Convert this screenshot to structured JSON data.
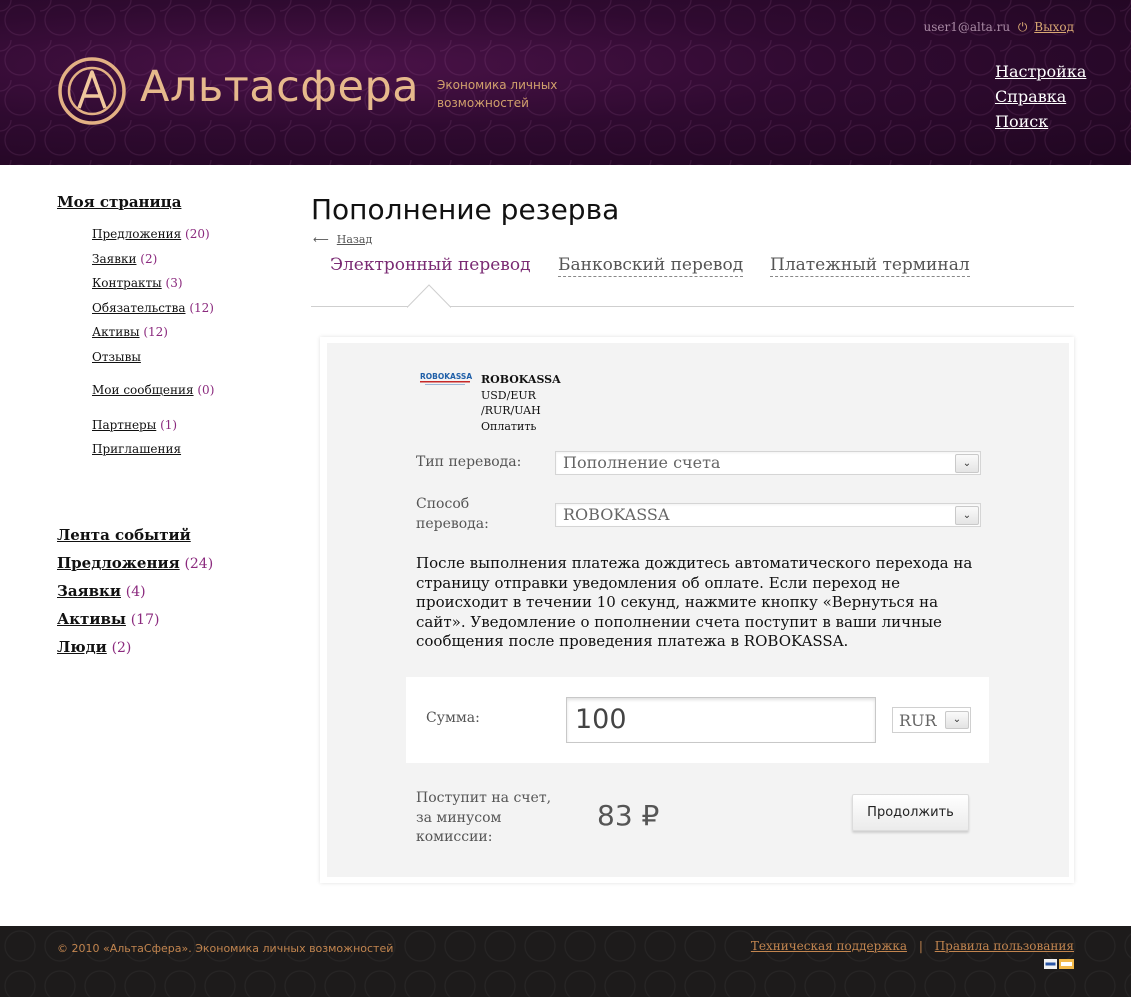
{
  "header": {
    "logo_text": "Альтасфера",
    "tagline": "Экономика личных возможностей",
    "user_email": "user1@alta.ru",
    "logout_label": "Выход",
    "nav": [
      "Настройка",
      "Справка",
      "Поиск"
    ],
    "colors": {
      "background": "#2f0a30",
      "logo": "#e6b98c"
    }
  },
  "sidebar": {
    "my_page": "Моя страница",
    "items": [
      {
        "label": "Предложения",
        "count": "(20)"
      },
      {
        "label": "Заявки",
        "count": "(2)"
      },
      {
        "label": "Контракты",
        "count": "(3)"
      },
      {
        "label": "Обязательства",
        "count": "(12)"
      },
      {
        "label": "Активы",
        "count": "(12)"
      },
      {
        "label": "Отзывы",
        "count": ""
      },
      {
        "label": "Мои сообщения",
        "count": "(0)"
      },
      {
        "label": "Партнеры",
        "count": "(1)"
      },
      {
        "label": "Приглашения",
        "count": ""
      }
    ],
    "sections": [
      {
        "label": "Лента событий",
        "count": ""
      },
      {
        "label": "Предложения",
        "count": "(24)"
      },
      {
        "label": "Заявки",
        "count": "(4)"
      },
      {
        "label": "Активы",
        "count": "(17)"
      },
      {
        "label": "Люди",
        "count": "(2)"
      }
    ],
    "colors": {
      "count": "#8b2a7e"
    }
  },
  "main": {
    "title": "Пополнение резерва",
    "back_label": "Назад",
    "tabs": [
      {
        "label": "Электронный перевод",
        "active": true
      },
      {
        "label": "Банковский перевод",
        "active": false
      },
      {
        "label": "Платежный терминал",
        "active": false
      }
    ],
    "payment": {
      "logo_text": "ROBOKASSA",
      "name": "ROBOKASSA",
      "currencies_line1": "USD/EUR",
      "currencies_line2": "/RUR/UAH",
      "action": "Оплатить"
    },
    "form": {
      "transfer_type_label": "Тип перевода:",
      "transfer_type_value": "Пополнение счета",
      "method_label_1": "Способ",
      "method_label_2": "перевода:",
      "method_value": "ROBOKASSA",
      "info_text": "После выполнения платежа дождитесь автоматического перехода на страницу отправки уведомления об оплате. Если переход не происходит в течении 10 секунд, нажмите кнопку «Вернуться на сайт». Уведомление о пополнении счета поступит в ваши личные сообщения после проведения платежа в ROBOKASSA.",
      "sum_label": "Сумма:",
      "sum_value": "100",
      "currency": "RUR",
      "receive_label_1": "Поступит на счет,",
      "receive_label_2": "за минусом",
      "receive_label_3": "комиссии:",
      "receive_amount": "83 ₽",
      "continue_label": "Продолжить"
    },
    "colors": {
      "active_tab": "#7a2a73",
      "panel": "#f3f3f3"
    }
  },
  "footer": {
    "copyright": "© 2010 «АльтаСфера». Экономика личных возможностей",
    "support_label": "Техническая поддержка",
    "separator": "|",
    "rules_label": "Правила пользования",
    "colors": {
      "background": "#1d1b1b",
      "text": "#c2854f"
    }
  }
}
